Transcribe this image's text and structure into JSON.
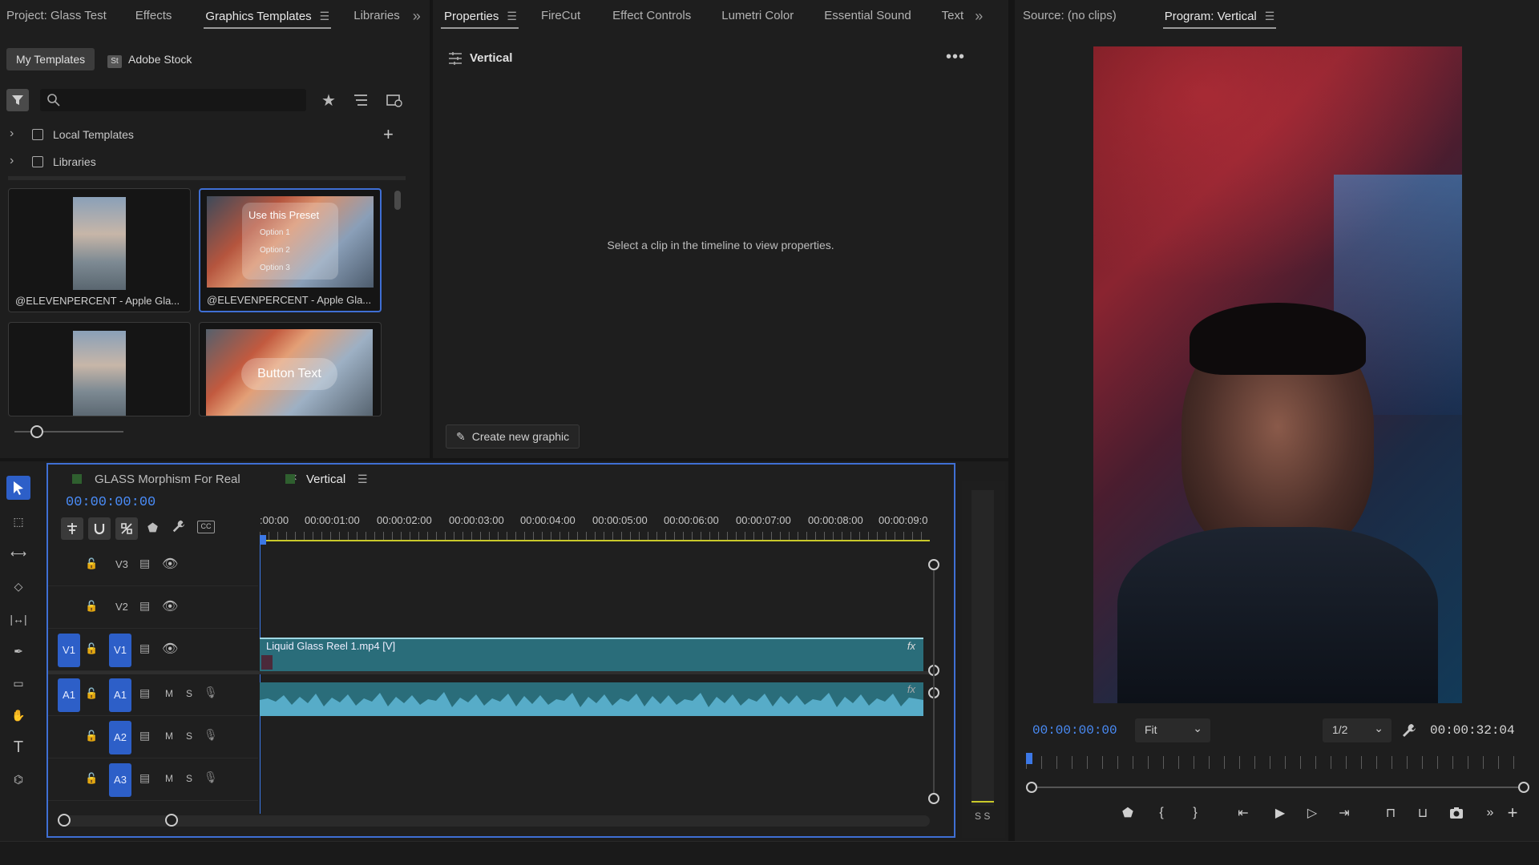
{
  "project_panel": {
    "tabs": [
      "Project: Glass Test",
      "Effects",
      "Graphics Templates",
      "Libraries"
    ],
    "active_tab": "Graphics Templates",
    "subtabs": {
      "my_templates": "My Templates",
      "adobe_stock": "Adobe Stock",
      "stock_badge": "St"
    },
    "tree": [
      {
        "label": "Local Templates"
      },
      {
        "label": "Libraries"
      }
    ],
    "templates": [
      {
        "caption": "@ELEVENPERCENT - Apple Gla...",
        "selected": false,
        "preview": "small-menu"
      },
      {
        "caption": "@ELEVENPERCENT - Apple Gla...",
        "selected": true,
        "preview": "menu"
      },
      {
        "caption": "",
        "selected": false,
        "preview": "small-button"
      },
      {
        "caption": "",
        "selected": false,
        "preview": "button"
      }
    ],
    "preview_menu": {
      "title": "Use this Preset",
      "options": [
        "Option 1",
        "Option 2",
        "Option 3"
      ]
    },
    "preview_button": "Button Text"
  },
  "properties_panel": {
    "tabs": [
      "Properties",
      "FireCut",
      "Effect Controls",
      "Lumetri Color",
      "Essential Sound",
      "Text"
    ],
    "active_tab": "Properties",
    "sequence_name": "Vertical",
    "empty_message": "Select a clip in the timeline to view properties.",
    "create_button": "Create new graphic"
  },
  "monitor_panel": {
    "tabs": [
      "Source: (no clips)",
      "Program: Vertical"
    ],
    "active_tab": "Program: Vertical",
    "current_time": "00:00:00:00",
    "fit": "Fit",
    "resolution": "1/2",
    "duration": "00:00:32:04"
  },
  "timeline": {
    "tabs": [
      "GLASS Morphism For Real",
      "Vertical"
    ],
    "active_tab": "Vertical",
    "current_time": "00:00:00:00",
    "ruler": [
      ":00:00",
      "00:00:01:00",
      "00:00:02:00",
      "00:00:03:00",
      "00:00:04:00",
      "00:00:05:00",
      "00:00:06:00",
      "00:00:07:00",
      "00:00:08:00",
      "00:00:09:0"
    ],
    "video_tracks": [
      "V3",
      "V2",
      "V1"
    ],
    "audio_tracks": [
      "A1",
      "A2",
      "A3"
    ],
    "source_patch_v": "V1",
    "source_patch_a": "A1",
    "mute_label": "M",
    "solo_label": "S",
    "video_clip": "Liquid Glass Reel 1.mp4 [V]",
    "fx": "fx",
    "meter_labels": "S S"
  },
  "colors": {
    "accent": "#4a8cf7",
    "selection": "#2d5fc8",
    "clip_video": "#2a6d7a",
    "clip_audio": "#2a6d7a",
    "waveform": "#5fb7d6",
    "playhead_bar": "#c9c92a"
  }
}
